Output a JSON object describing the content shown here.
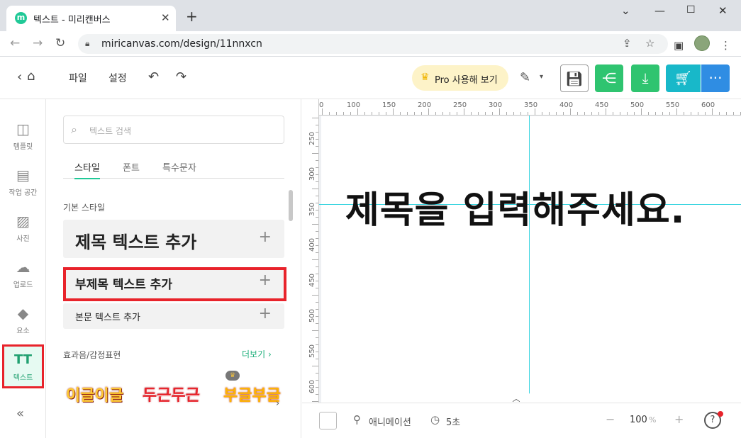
{
  "browser": {
    "tab_title": "텍스트 - 미리캔버스",
    "favicon_letter": "m",
    "url": "miricanvas.com/design/11nnxcn"
  },
  "header": {
    "file_label": "파일",
    "settings_label": "설정",
    "pro_label": "Pro 사용해 보기"
  },
  "rail": {
    "items": [
      {
        "label": "템플릿",
        "icon": "template-icon"
      },
      {
        "label": "작업 공간",
        "icon": "workspace-icon"
      },
      {
        "label": "사진",
        "icon": "photo-icon"
      },
      {
        "label": "업로드",
        "icon": "upload-icon"
      },
      {
        "label": "요소",
        "icon": "elements-icon"
      },
      {
        "label": "텍스트",
        "icon": "text-icon"
      }
    ]
  },
  "panel": {
    "search_placeholder": "텍스트 검색",
    "tabs": [
      "스타일",
      "폰트",
      "특수문자"
    ],
    "basic_style_title": "기본 스타일",
    "add_title": "제목 텍스트 추가",
    "add_subtitle": "부제목 텍스트 추가",
    "add_body": "본문 텍스트 추가",
    "effects_title": "효과음/감정표현",
    "more_label": "더보기",
    "stickers": [
      "이글이글",
      "두근두근",
      "부글부글"
    ]
  },
  "canvas": {
    "title_text": "제목을 입력해주세요.",
    "ruler_h": [
      "0",
      "100",
      "150",
      "200",
      "250",
      "300",
      "350",
      "400",
      "450",
      "500",
      "550",
      "600"
    ],
    "ruler_v": [
      "250",
      "300",
      "350",
      "400",
      "450",
      "500",
      "550",
      "600"
    ]
  },
  "bottombar": {
    "animation_label": "애니메이션",
    "duration_label": "5초",
    "zoom_value": "100",
    "zoom_unit": "%"
  },
  "colors": {
    "accent_green": "#20c997",
    "highlight_red": "#e8232b",
    "guide_cyan": "#38d4e0"
  }
}
